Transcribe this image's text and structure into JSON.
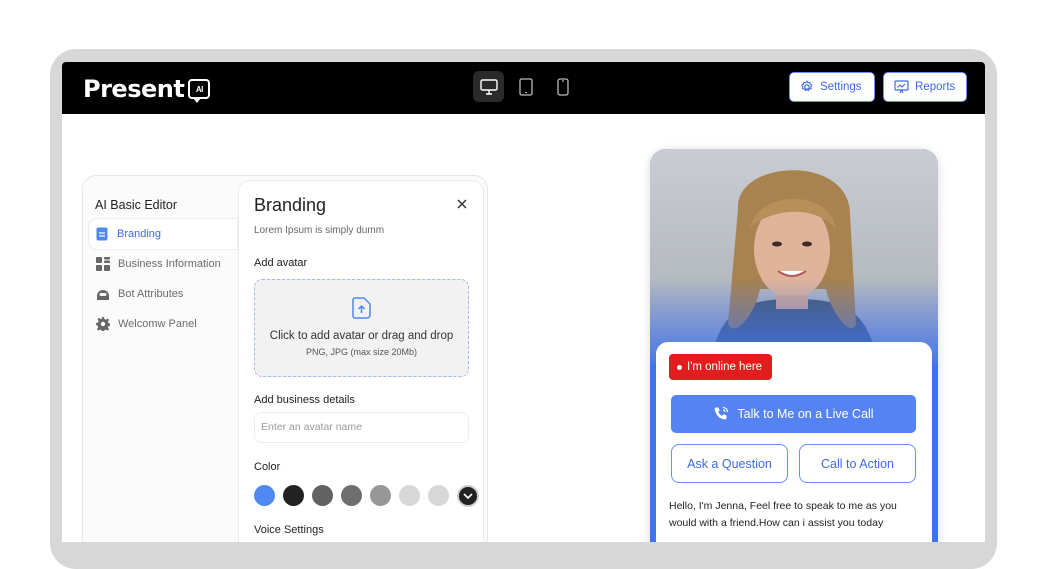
{
  "app": {
    "logo_text": "Present",
    "logo_badge": "AI"
  },
  "header": {
    "device_toggles": [
      {
        "icon": "desktop-icon",
        "active": true
      },
      {
        "icon": "tablet-icon",
        "active": false
      },
      {
        "icon": "mobile-icon",
        "active": false
      }
    ],
    "settings_label": "Settings",
    "reports_label": "Reports"
  },
  "editor": {
    "title": "AI Basic Editor",
    "nav": [
      {
        "label": "Branding",
        "icon": "document-icon",
        "active": true
      },
      {
        "label": "Business Information",
        "icon": "grid-icon",
        "active": false
      },
      {
        "label": "Bot Attributes",
        "icon": "bot-icon",
        "active": false
      },
      {
        "label": "Welcomw Panel",
        "icon": "gear-icon",
        "active": false
      }
    ]
  },
  "branding": {
    "title": "Branding",
    "subtitle": "Lorem Ipsum is simply dumm",
    "avatar_label": "Add avatar",
    "upload_text": "Click to add avatar or drag and drop",
    "upload_hint": "PNG, JPG (max size 20Mb)",
    "business_label": "Add business details",
    "name_placeholder": "Enter an avatar name",
    "color_label": "Color",
    "colors": [
      "#4f87f3",
      "#222222",
      "#626262",
      "#6e6e6e",
      "#979797",
      "#d7d7d7",
      "#d7d7d7"
    ],
    "voice_label": "Voice Settings"
  },
  "preview": {
    "online_label": "I'm online here",
    "live_call_label": "Talk to Me on a Live Call",
    "ask_label": "Ask a Question",
    "cta_label": "Call to Action",
    "message": "Hello, I'm Jenna, Feel free to speak to me as you would with a friend.How can i assist you today"
  },
  "theme": {
    "accent": "#3e68e6",
    "online_red": "#e21d1d",
    "phone_bg": "#3f72f0"
  }
}
